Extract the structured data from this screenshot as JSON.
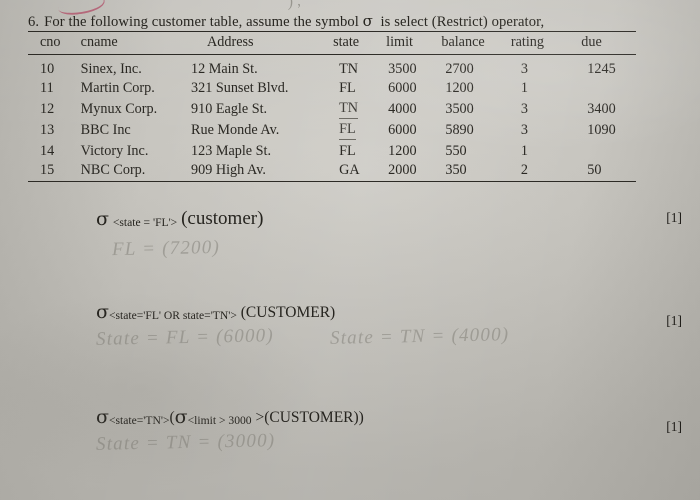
{
  "document": {
    "question_number": "6.",
    "question_text": "For the following customer table, assume the symbol",
    "sigma_symbol": "σ",
    "question_text_tail": "is select (Restrict) operator,",
    "paper_color": "#c7c5bf",
    "ink_color": "#26241f",
    "annotation_color": "#b2516a"
  },
  "stray_marks": {
    "top_pencil": ") ,"
  },
  "table": {
    "name": "customer",
    "columns": [
      "cno",
      "cname",
      "Address",
      "state",
      "limit",
      "balance",
      "rating",
      "due"
    ],
    "rows": [
      {
        "cno": "10",
        "cname": "Sinex, Inc.",
        "address": "12 Main St.",
        "state": "TN",
        "limit": "3500",
        "balance": "2700",
        "rating": "3",
        "due": "1245",
        "state_underlined": false
      },
      {
        "cno": "11",
        "cname": "Martin Corp.",
        "address": "321 Sunset Blvd.",
        "state": "FL",
        "limit": "6000",
        "balance": "1200",
        "rating": "1",
        "due": "",
        "state_underlined": false
      },
      {
        "cno": "12",
        "cname": "Mynux Corp.",
        "address": "910 Eagle St.",
        "state": "TN",
        "limit": "4000",
        "balance": "3500",
        "rating": "3",
        "due": "3400",
        "state_underlined": true
      },
      {
        "cno": "13",
        "cname": "BBC Inc",
        "address": "Rue Monde Av.",
        "state": "FL",
        "limit": "6000",
        "balance": "5890",
        "rating": "3",
        "due": "1090",
        "state_underlined": true
      },
      {
        "cno": "14",
        "cname": "Victory Inc.",
        "address": "123 Maple St.",
        "state": "FL",
        "limit": "1200",
        "balance": "550",
        "rating": "1",
        "due": "",
        "state_underlined": false
      },
      {
        "cno": "15",
        "cname": "NBC Corp.",
        "address": "909 High Av.",
        "state": "GA",
        "limit": "2000",
        "balance": "350",
        "rating": "2",
        "due": "50",
        "state_underlined": false
      }
    ]
  },
  "questions": [
    {
      "id": "a",
      "sigma": "σ",
      "condition": "<state = 'FL'>",
      "relation": "(customer)",
      "mark": "[1]",
      "student_answer": "FL = (7200)"
    },
    {
      "id": "b",
      "sigma": "σ",
      "condition": "<state='FL' OR state='TN'>",
      "relation": "(CUSTOMER)",
      "mark": "[1]",
      "student_answer": "State = FL = (6000)",
      "student_answer_2": "State = TN = (4000)"
    },
    {
      "id": "c",
      "sigma": "σ",
      "condition": "<state='TN'>",
      "inner_sigma": "σ",
      "inner_condition": "<limit > 3000",
      "relation": ">(CUSTOMER))",
      "open_paren": "(",
      "mark": "[1]",
      "student_answer": "State = TN = (3000)"
    }
  ]
}
